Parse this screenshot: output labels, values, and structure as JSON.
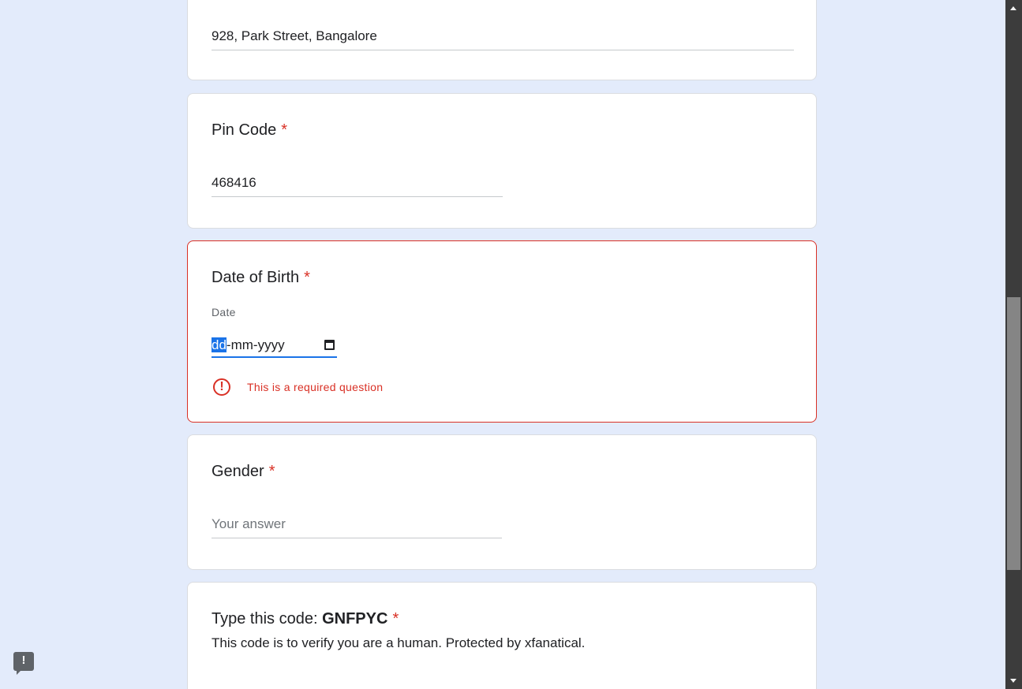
{
  "address": {
    "value": "928, Park Street, Bangalore"
  },
  "pin_code": {
    "title": "Pin Code",
    "required_mark": "*",
    "value": "468416"
  },
  "date_of_birth": {
    "title": "Date of Birth",
    "required_mark": "*",
    "sub_label": "Date",
    "day_placeholder": "dd",
    "rest_placeholder": "-mm-yyyy",
    "error_text": "This is a required question",
    "error_icon": "!"
  },
  "gender": {
    "title": "Gender",
    "required_mark": "*",
    "placeholder": "Your answer"
  },
  "captcha": {
    "title_prefix": "Type this code:",
    "code": "GNFPYC",
    "required_mark": "*",
    "description": "This code is to verify you are a human. Protected by xfanatical."
  },
  "feedback": {
    "icon_glyph": "!"
  },
  "colors": {
    "background": "#e3ebfb",
    "error": "#d93025",
    "focus": "#1a73e8"
  }
}
